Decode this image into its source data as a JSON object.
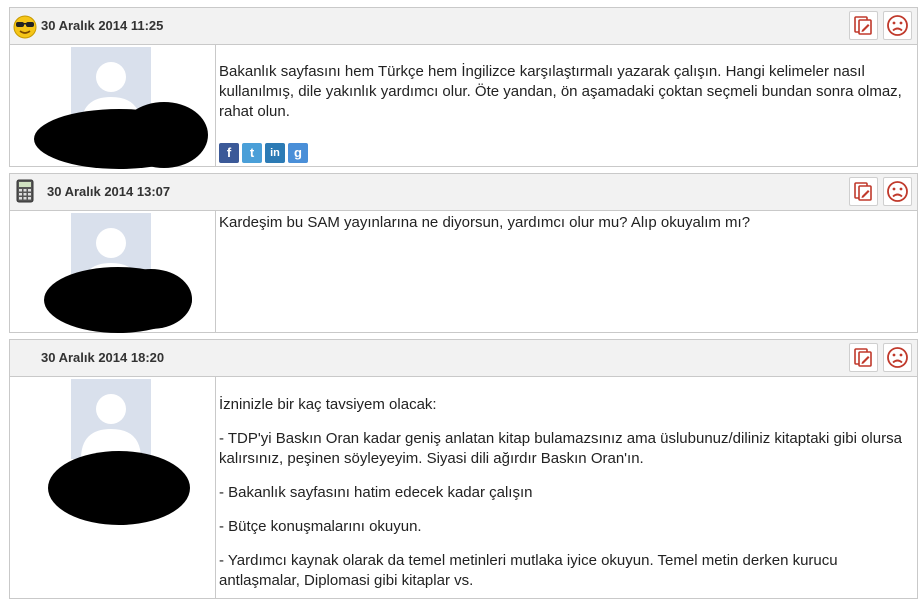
{
  "posts": [
    {
      "icon": "sunglasses-smiley-icon",
      "date": "30 Aralık 2014 11:25",
      "paragraphs": [
        "Bakanlık sayfasını hem Türkçe hem İngilizce karşılaştırmalı yazarak çalışın. Hangi kelimeler nasıl kullanılmış, dile yakınlık yardımcı olur. Öte yandan, ön aşamadaki çoktan seçmeli bundan sonra olmaz, rahat olun."
      ],
      "share": [
        {
          "name": "facebook-icon",
          "glyph": "f",
          "color": "#3b5998"
        },
        {
          "name": "twitter-icon",
          "glyph": "t",
          "color": "#4a9fd8"
        },
        {
          "name": "linkedin-icon",
          "glyph": "in",
          "color": "#2c7bb5"
        },
        {
          "name": "google-plus-icon",
          "glyph": "g",
          "color": "#4a8fd8"
        }
      ]
    },
    {
      "icon": "calculator-icon",
      "date": "30 Aralık 2014 13:07",
      "paragraphs": [
        "Kardeşim bu SAM yayınlarına ne diyorsun, yardımcı olur mu? Alıp okuyalım mı?"
      ]
    },
    {
      "icon": "",
      "date": "30 Aralık 2014 18:20",
      "paragraphs": [
        "İzninizle bir kaç tavsiyem olacak:",
        "- TDP'yi Baskın Oran kadar geniş anlatan kitap bulamazsınız ama üslubunuz/diliniz kitaptaki gibi olursa kalırsınız, peşinen söyleyeyim. Siyasi dili ağırdır Baskın Oran'ın.",
        "- Bakanlık sayfasını hatim edecek kadar çalışın",
        "- Bütçe konuşmalarını okuyun.",
        "- Yardımcı kaynak olarak da temel metinleri mutlaka iyice okuyun. Temel metin derken kurucu antlaşmalar, Diplomasi gibi kitaplar vs."
      ]
    }
  ]
}
